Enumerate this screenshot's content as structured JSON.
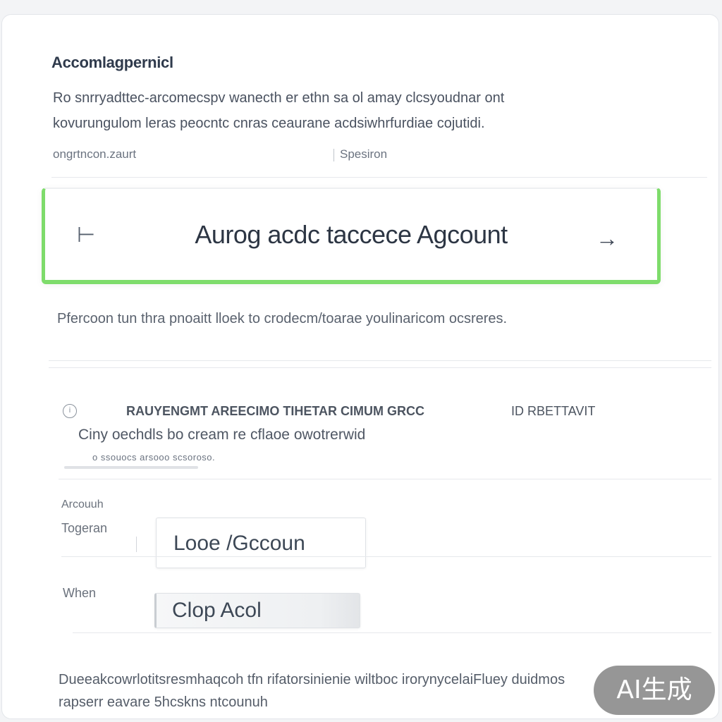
{
  "page": {
    "title": "Accomlagpernicl",
    "description_line1": "Ro snrryadttec-arcomecspv wanecth er ethn sa ol amay clcsyoudnar ont",
    "description_line2": "kovurungulom leras peocntc cnras ceaurane acdsiwhrfurdiae cojutidi.",
    "meta_left": "ongrtncon.zaurt",
    "meta_right": "Spesiron"
  },
  "account_bar": {
    "back_icon": "back-icon",
    "label": "Aurog acdc taccece Agcount",
    "arrow_icon": "arrow-right-icon",
    "accent_color": "#7edc6b"
  },
  "hint": "Pfercoon tun thra pnoaitt lloek to crodecm/toarae youlinaricom ocsreres.",
  "notice": {
    "icon": "info-icon",
    "title": "RAUYENGMT AREECIMO TIHETAR CIMUM GRCC",
    "tag": "ID RBETTAVIT",
    "body": "Ciny oechdls bo cream re cflaoe owotrerwid",
    "link": "o ssouocs arsooo scsoroso."
  },
  "fields": {
    "account_label_top": "Arcouuh",
    "account_label": "Togeran",
    "account_value": "Looe /Gccoun",
    "when_label": "When",
    "when_value": "Clop Acol"
  },
  "footer": {
    "line1": "Dueeakcowrlotitsresmhaqcoh tfn rifatorsinienie wiltboc irorynycelaiFluey duidmos",
    "line2": "rapserr eavare 5hcskns ntcounuh"
  },
  "watermark": "AI生成"
}
